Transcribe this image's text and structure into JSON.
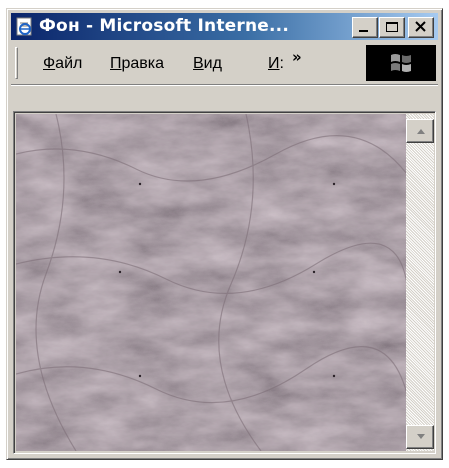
{
  "window": {
    "title": "Фон - Microsoft Interne...",
    "titlebar_colors": [
      "#0a246a",
      "#a6caf0"
    ]
  },
  "menu": {
    "items": [
      {
        "label_hot": "Ф",
        "label_rest": "айл"
      },
      {
        "label_hot": "П",
        "label_rest": "равка"
      },
      {
        "label_hot": "В",
        "label_rest": "ид"
      },
      {
        "label_hot": "И",
        "label_rest": ":"
      }
    ],
    "overflow": "»"
  },
  "content": {
    "background": "marble-texture",
    "base_color": "#5e4f5a"
  },
  "icons": {
    "app": "internet-explorer-icon",
    "min": "minimize-icon",
    "max": "maximize-icon",
    "close": "close-icon",
    "throbber": "windows-logo-icon"
  }
}
